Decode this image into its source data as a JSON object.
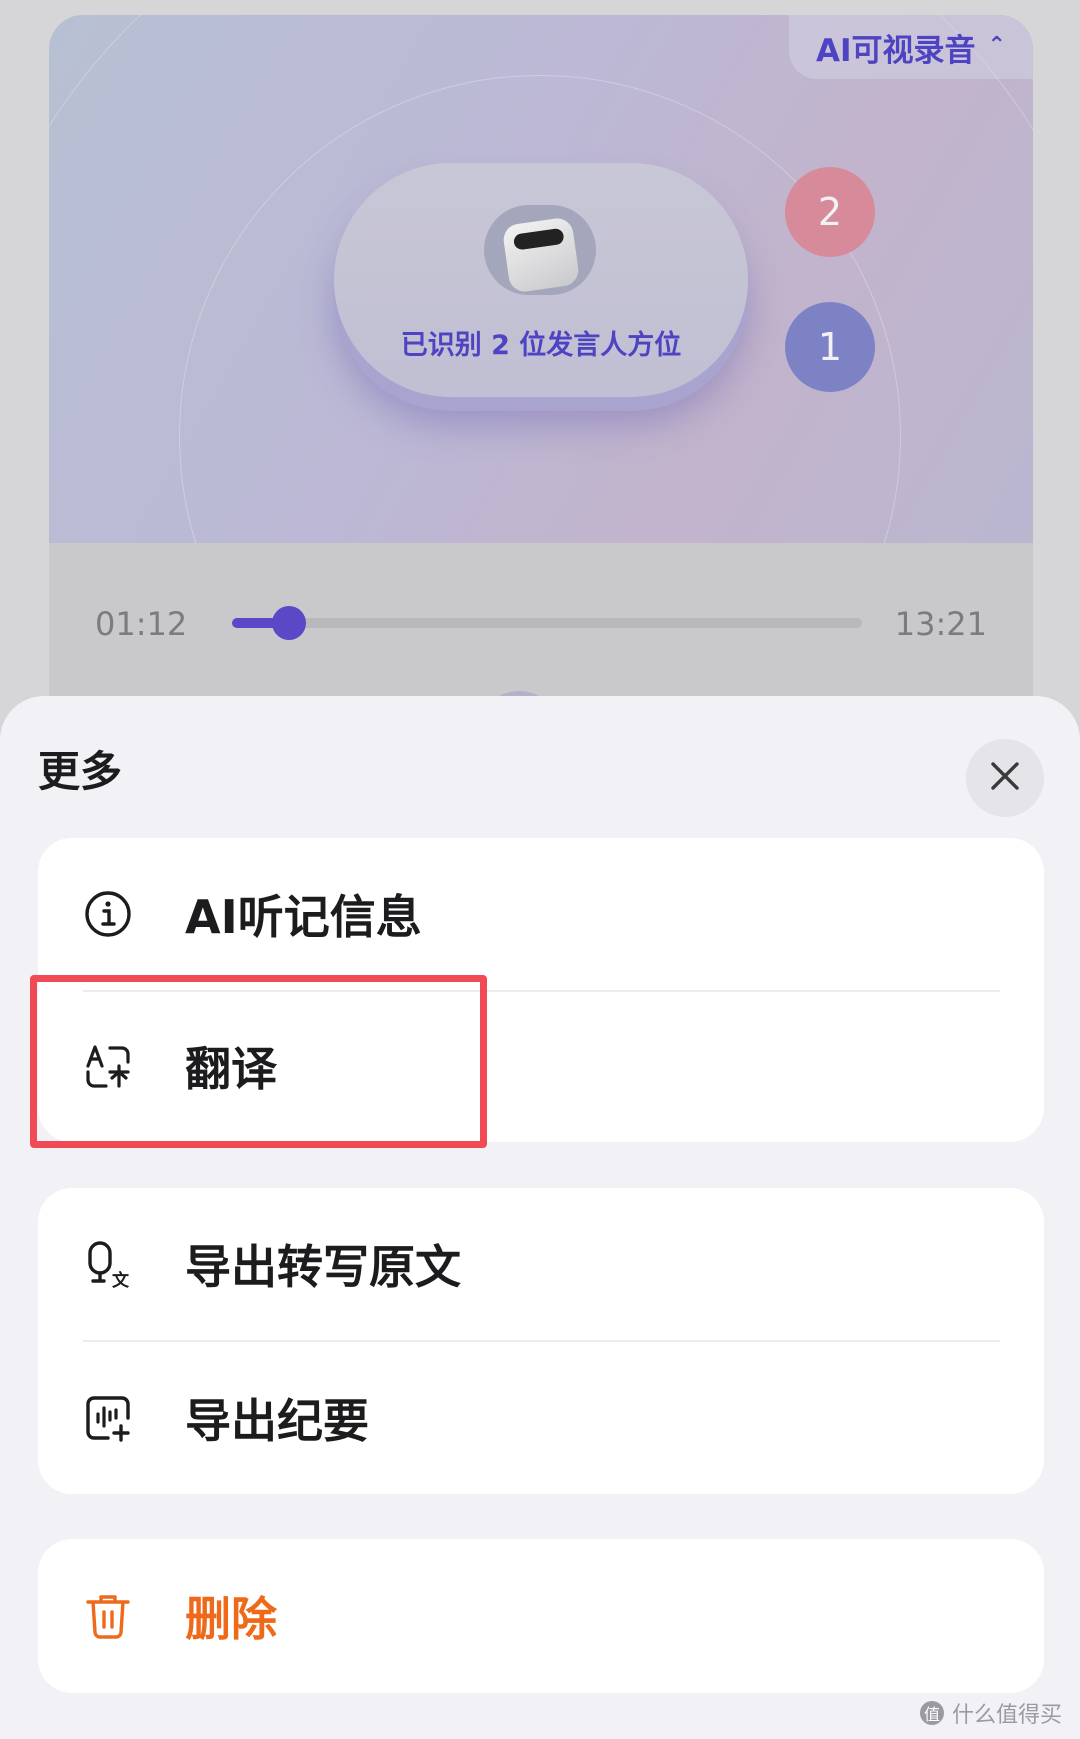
{
  "background": {
    "ai_tag_label": "AI可视录音",
    "ai_tag_chevron": "⌃",
    "speaker_status": "已识别 2 位发言人方位",
    "speakers": [
      "2",
      "1"
    ],
    "player": {
      "current_time": "01:12",
      "total_time": "13:21",
      "progress": 0.09
    }
  },
  "sheet": {
    "title": "更多",
    "close_icon": "close-icon",
    "groups": [
      {
        "items": [
          {
            "icon": "info-icon",
            "label": "AI听记信息"
          },
          {
            "icon": "translate-icon",
            "label": "翻译"
          }
        ]
      },
      {
        "items": [
          {
            "icon": "export-transcript-icon",
            "label": "导出转写原文"
          },
          {
            "icon": "export-summary-icon",
            "label": "导出纪要"
          }
        ]
      },
      {
        "items": [
          {
            "icon": "trash-icon",
            "label": "删除",
            "color": "#ee6a1a"
          }
        ]
      }
    ]
  },
  "watermark": {
    "badge": "值",
    "text": "什么值得买"
  },
  "colors": {
    "accent": "#4e43c2",
    "danger": "#ee6a1a",
    "highlight": "#f24a55"
  }
}
